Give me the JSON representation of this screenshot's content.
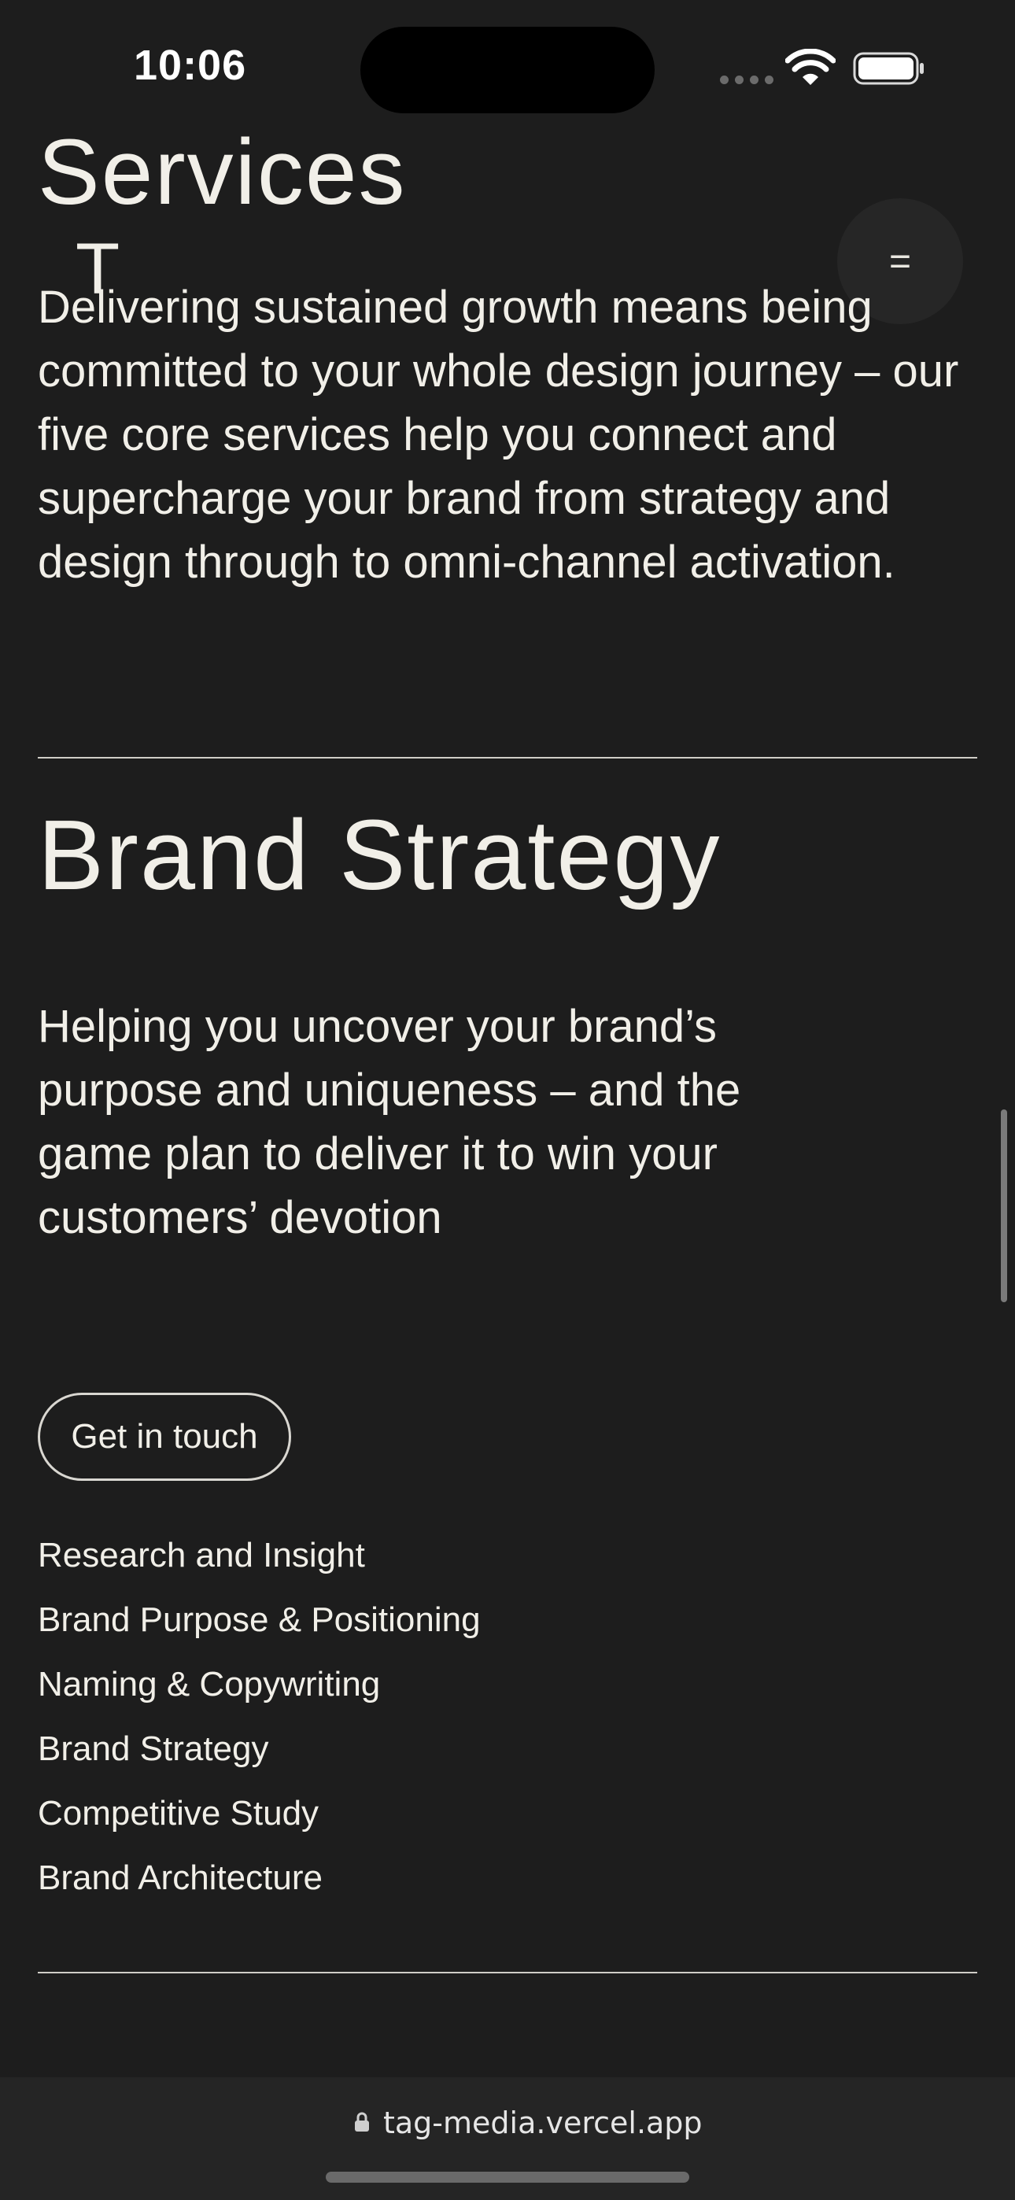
{
  "status_bar": {
    "time": "10:06"
  },
  "header": {
    "page_title": "Services",
    "logo_letter": "T",
    "menu_icon": "hamburger-icon",
    "menu_glyph": "="
  },
  "intro": {
    "text": "Delivering sustained growth means being committed to your whole design journey – our five core services help you connect and supercharge your brand from strategy and design through to omni-channel activation."
  },
  "section": {
    "title": "Brand Strategy",
    "description": "Helping you uncover your brand’s purpose and uniqueness – and the game plan to deliver it to win your customers’ devotion",
    "cta_label": "Get in touch",
    "services": [
      "Research and Insight",
      "Brand Purpose & Positioning",
      "Naming & Copywriting",
      "Brand Strategy",
      "Competitive Study",
      "Brand Architecture"
    ]
  },
  "browser": {
    "url": "tag-media.vercel.app",
    "lock_icon": "lock-icon"
  },
  "colors": {
    "background": "#1d1d1d",
    "text": "#f1efe8",
    "browser_bar": "#252525"
  }
}
